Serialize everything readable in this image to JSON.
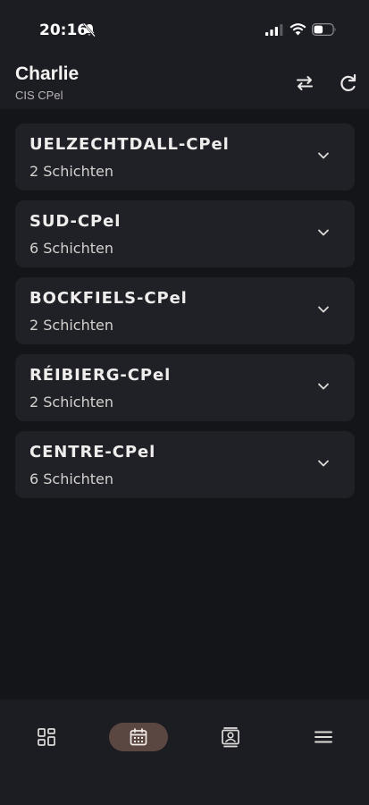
{
  "status_bar": {
    "time": "20:16",
    "icons": [
      "bell-muted-icon",
      "signal-icon",
      "wifi-icon",
      "battery-icon"
    ]
  },
  "header": {
    "title": "Charlie",
    "subtitle": "CIS CPel",
    "actions": [
      "swap-icon",
      "refresh-icon"
    ]
  },
  "stations": [
    {
      "name": "UELZECHTDALL-CPel",
      "shifts": "2 Schichten"
    },
    {
      "name": "SUD-CPel",
      "shifts": "6 Schichten"
    },
    {
      "name": "BOCKFIELS-CPel",
      "shifts": "2 Schichten"
    },
    {
      "name": "RÉIBIERG-CPel",
      "shifts": "2 Schichten"
    },
    {
      "name": "CENTRE-CPel",
      "shifts": "6 Schichten"
    }
  ],
  "bottom_nav": {
    "items": [
      "dashboard-icon",
      "calendar-icon",
      "contacts-icon",
      "menu-icon"
    ],
    "active": "calendar-icon"
  },
  "colors": {
    "background": "#141519",
    "surface": "#202127",
    "bar": "#1c1d23",
    "active_nav": "#5b4741"
  }
}
